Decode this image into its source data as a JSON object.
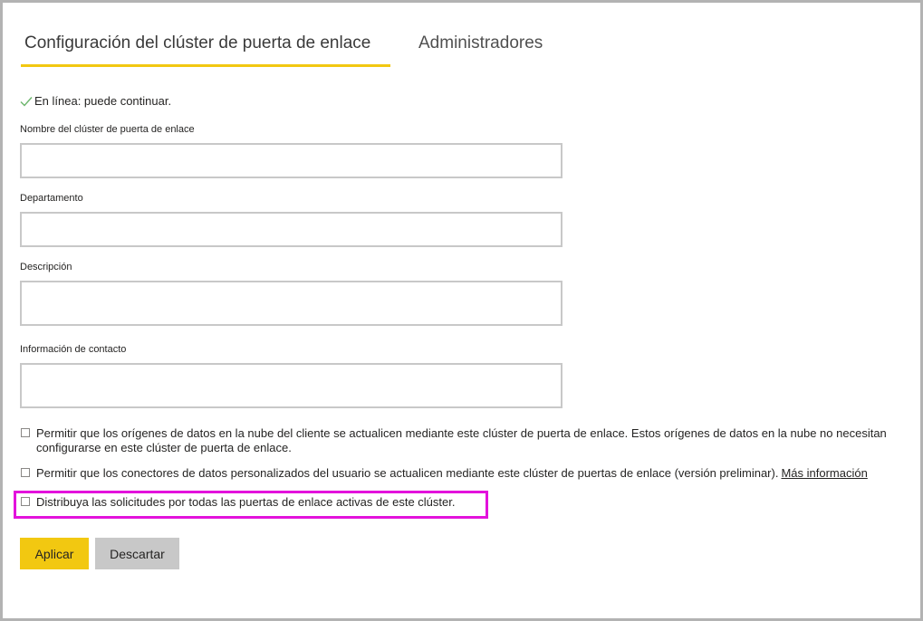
{
  "tabs": {
    "config_label": "Configuración del clúster de puerta de enlace",
    "admins_label": "Administradores"
  },
  "status": {
    "text": "En línea: puede continuar.",
    "icon": "check-icon",
    "color": "#6bb56b"
  },
  "form": {
    "cluster_name_label": "Nombre del clúster de puerta de enlace",
    "cluster_name_value": "",
    "department_label": "Departamento",
    "department_value": "",
    "description_label": "Descripción",
    "description_value": "",
    "contact_label": "Información de contacto",
    "contact_value": ""
  },
  "options": {
    "cloud_refresh_text": "Permitir que los orígenes de datos en la nube del cliente se actualicen mediante este clúster de puerta de enlace. Estos orígenes de datos en la nube no necesitan configurarse en este clúster de puerta de enlace.",
    "custom_connectors_text": "Permitir que los conectores de datos personalizados del usuario se actualicen mediante este clúster de puertas de enlace (versión preliminar).",
    "more_info_link": "Más información",
    "distribute_text": "Distribuya las solicitudes por todas las puertas de enlace activas de este clúster."
  },
  "buttons": {
    "apply_label": "Aplicar",
    "discard_label": "Descartar"
  },
  "colors": {
    "accent": "#f2c811",
    "highlight": "#e312dc",
    "secondary_button": "#c8c8c8"
  }
}
